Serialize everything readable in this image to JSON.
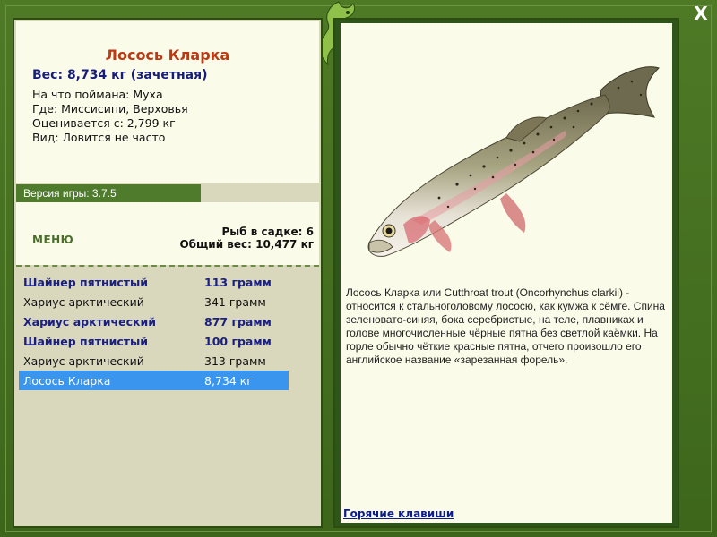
{
  "fish": {
    "title": "Лосось Кларка",
    "weight_line": "Вес: 8,734 кг (зачетная)",
    "meta": [
      "На что поймана: Муха",
      "Где: Миссисипи, Верховья",
      "Оценивается с: 2,799 кг",
      "Вид: Ловится не часто"
    ],
    "description": "Лосось Кларка или Cutthroat trout (Oncorhynchus clarkii) - относится к стальноголовому лососю, как кумжа к сёмге. Спина зеленовато-синяя, бока серебристые, на теле, плавниках и голове многочисленные чёрные пятна без светлой каёмки. На горле обычно чёткие красные пятна, отчего произошло его английское название «зарезанная форель»."
  },
  "version": "Версия игры: 3.7.5",
  "menu_label": "МЕНЮ",
  "cage": {
    "count_line": "Рыб в садке: 6",
    "total_line": "Общий вес: 10,477 кг"
  },
  "catches": [
    {
      "name": "Шайнер пятнистый",
      "weight": "113 грамм",
      "style": "bold"
    },
    {
      "name": "Хариус арктический",
      "weight": "341 грамм",
      "style": "normal"
    },
    {
      "name": "Хариус арктический",
      "weight": "877 грамм",
      "style": "bold"
    },
    {
      "name": "Шайнер пятнистый",
      "weight": "100 грамм",
      "style": "bold"
    },
    {
      "name": "Хариус арктический",
      "weight": "313 грамм",
      "style": "normal"
    },
    {
      "name": "Лосось Кларка",
      "weight": "8,734 кг",
      "style": "selected"
    }
  ],
  "hotkeys_label": "Горячие клавиши",
  "close_label": "X",
  "icons": {
    "close": "close-icon",
    "logo": "dragon-logo-icon",
    "fish": "trout-image"
  },
  "colors": {
    "frame_green": "#3f6b1e",
    "panel_cream": "#fbfbe9",
    "title_red": "#bb3a13",
    "text_navy": "#171d7a",
    "selection_blue": "#3a95ee",
    "link_blue": "#0b1c8e"
  }
}
